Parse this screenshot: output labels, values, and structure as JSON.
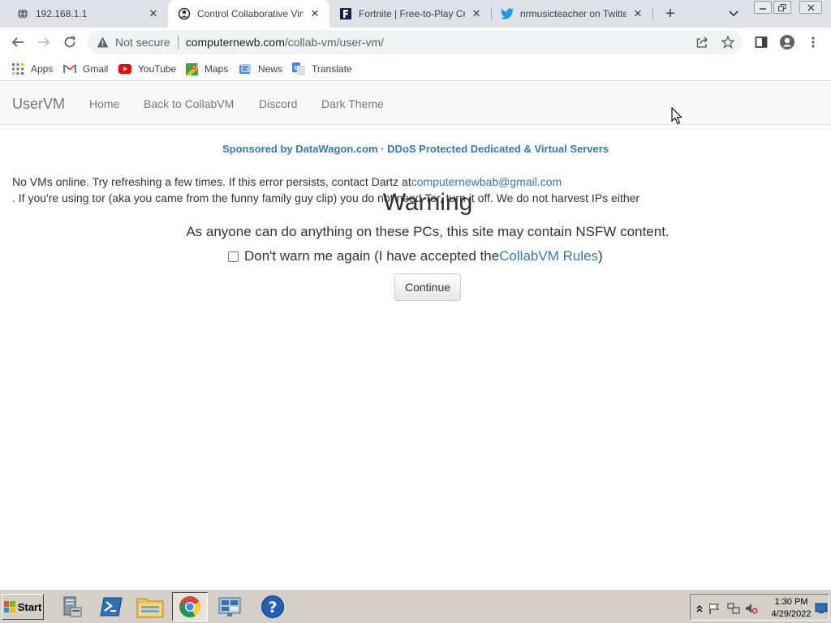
{
  "tabs": [
    {
      "title": "192.168.1.1",
      "icon": "globe-icon",
      "active": false
    },
    {
      "title": "Control Collaborative Virtual",
      "icon": "collabvm-icon",
      "active": true
    },
    {
      "title": "Fortnite | Free-to-Play Cross",
      "icon": "fortnite-icon",
      "active": false
    },
    {
      "title": "nrmusicteacher on Twitter:",
      "icon": "twitter-icon",
      "active": false
    }
  ],
  "toolbar": {
    "security_label": "Not secure",
    "url_host": "computernewb.com",
    "url_path": "/collab-vm/user-vm/"
  },
  "bookmarks": [
    {
      "label": "Apps",
      "icon": "apps-grid-icon"
    },
    {
      "label": "Gmail",
      "icon": "gmail-icon"
    },
    {
      "label": "YouTube",
      "icon": "youtube-icon"
    },
    {
      "label": "Maps",
      "icon": "maps-icon"
    },
    {
      "label": "News",
      "icon": "news-icon"
    },
    {
      "label": "Translate",
      "icon": "translate-icon"
    }
  ],
  "navbar": {
    "brand": "UserVM",
    "links": [
      "Home",
      "Back to CollabVM",
      "Discord",
      "Dark Theme"
    ]
  },
  "sponsor": "Sponsored by DataWagon.com · DDoS Protected Dedicated & Virtual Servers",
  "error": {
    "line1": "No VMs online. Try refreshing a few times. If this error persists, contact Dartz at",
    "email": "computernewbab@gmail.com",
    "line2": ". If you're using tor (aka you came from the funny family guy clip) you do not need Tor, turn it off. We do not harvest IPs either"
  },
  "warning": {
    "heading": "Warning",
    "message": "As anyone can do anything on these PCs, this site may contain NSFW content.",
    "checkbox_text": "Don't warn me again (I have accepted the ",
    "rules_link": "CollabVM Rules",
    "checkbox_close": ")",
    "checked": false,
    "continue_label": "Continue"
  },
  "taskbar": {
    "start_label": "Start",
    "apps": [
      "server-manager-icon",
      "powershell-icon",
      "explorer-icon",
      "chrome-icon",
      "control-panel-icon",
      "help-icon"
    ],
    "clock_time": "1:30 PM",
    "clock_date": "4/29/2022"
  },
  "colors": {
    "link": "#337ab7",
    "tabstrip": "#dee1e6",
    "taskbar": "#d4d0c8"
  }
}
